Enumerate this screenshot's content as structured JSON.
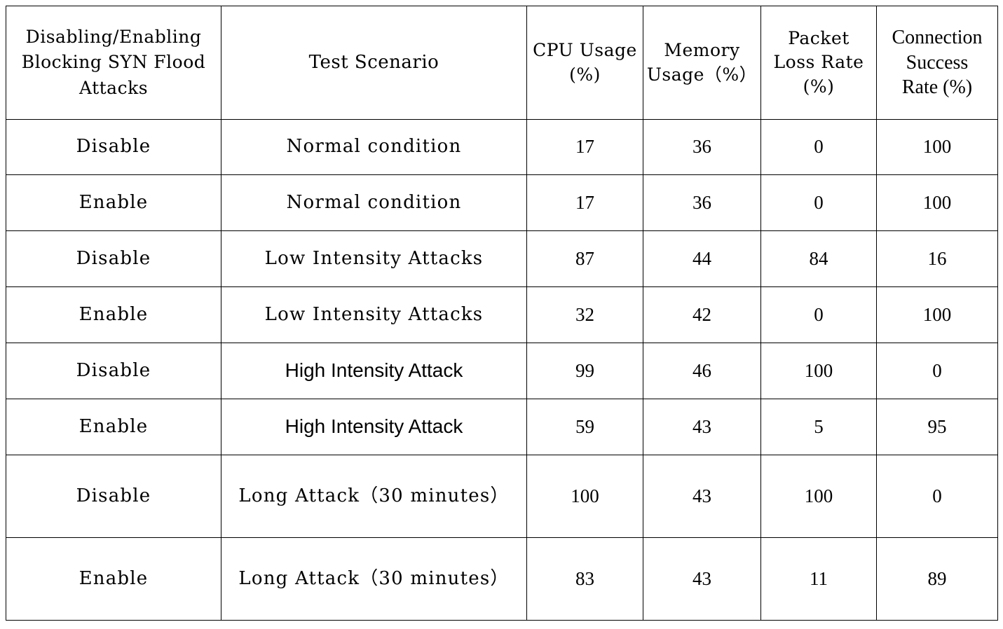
{
  "table": {
    "columns": [
      {
        "id": "toggle",
        "lines": [
          "Disabling/Enabling",
          "Blocking SYN Flood",
          "Attacks"
        ],
        "style": "mono"
      },
      {
        "id": "scenario",
        "lines": [
          "Test Scenario"
        ],
        "style": "mono"
      },
      {
        "id": "cpu",
        "lines": [
          "CPU Usage",
          "(%)"
        ],
        "style": "mono"
      },
      {
        "id": "memory",
        "lines": [
          "Memory",
          "Usage（%）"
        ],
        "style": "mono"
      },
      {
        "id": "loss",
        "lines": [
          "Packet",
          "Loss Rate",
          "(%)"
        ],
        "style": "mono"
      },
      {
        "id": "conn",
        "lines": [
          "Connection",
          "Success",
          "Rate (%)"
        ],
        "style": "serif-bold"
      }
    ],
    "header_texts": {
      "toggle_l1": "Disabling/Enabling",
      "toggle_l2": "Blocking SYN Flood",
      "toggle_l3": "Attacks",
      "scenario": "Test Scenario",
      "cpu_l1": "CPU Usage",
      "cpu_l2": "(%)",
      "memory_l1": "Memory",
      "memory_l2": "Usage（%）",
      "loss_l1": "Packet",
      "loss_l2": "Loss Rate",
      "loss_l3": "(%)",
      "conn_l1": "Connection",
      "conn_l2": "Success",
      "conn_l3": "Rate (%)"
    },
    "rows": [
      {
        "toggle": "Disable",
        "scenario": "Normal condition",
        "scenario_style": "mono",
        "cpu": "17",
        "memory": "36",
        "loss": "0",
        "conn": "100",
        "height": "first"
      },
      {
        "toggle": "Enable",
        "scenario": "Normal condition",
        "scenario_style": "mono",
        "cpu": "17",
        "memory": "36",
        "loss": "0",
        "conn": "100",
        "height": "std"
      },
      {
        "toggle": "Disable",
        "scenario": "Low Intensity Attacks",
        "scenario_style": "mono",
        "cpu": "87",
        "memory": "44",
        "loss": "84",
        "conn": "16",
        "height": "std"
      },
      {
        "toggle": "Enable",
        "scenario": "Low Intensity Attacks",
        "scenario_style": "mono",
        "cpu": "32",
        "memory": "42",
        "loss": "0",
        "conn": "100",
        "height": "std"
      },
      {
        "toggle": "Disable",
        "scenario": "High Intensity Attack",
        "scenario_style": "sans",
        "cpu": "99",
        "memory": "46",
        "loss": "100",
        "conn": "0",
        "height": "std"
      },
      {
        "toggle": "Enable",
        "scenario": "High Intensity Attack",
        "scenario_style": "sans",
        "cpu": "59",
        "memory": "43",
        "loss": "5",
        "conn": "95",
        "height": "std"
      },
      {
        "toggle": "Disable",
        "scenario": "Long Attack（30 minutes）",
        "scenario_style": "mono",
        "cpu": "100",
        "memory": "43",
        "loss": "100",
        "conn": "0",
        "height": "tall"
      },
      {
        "toggle": "Enable",
        "scenario": "Long Attack（30 minutes）",
        "scenario_style": "mono",
        "cpu": "83",
        "memory": "43",
        "loss": "11",
        "conn": "89",
        "height": "tall"
      }
    ]
  },
  "chart_data": {
    "type": "table",
    "title": "",
    "columns": [
      "Disabling/Enabling Blocking SYN Flood Attacks",
      "Test Scenario",
      "CPU Usage (%)",
      "Memory Usage (%)",
      "Packet Loss Rate (%)",
      "Connection Success Rate (%)"
    ],
    "rows": [
      [
        "Disable",
        "Normal condition",
        17,
        36,
        0,
        100
      ],
      [
        "Enable",
        "Normal condition",
        17,
        36,
        0,
        100
      ],
      [
        "Disable",
        "Low Intensity Attacks",
        87,
        44,
        84,
        16
      ],
      [
        "Enable",
        "Low Intensity Attacks",
        32,
        42,
        0,
        100
      ],
      [
        "Disable",
        "High Intensity Attack",
        99,
        46,
        100,
        0
      ],
      [
        "Enable",
        "High Intensity Attack",
        59,
        43,
        5,
        95
      ],
      [
        "Disable",
        "Long Attack (30 minutes)",
        100,
        43,
        100,
        0
      ],
      [
        "Enable",
        "Long Attack (30 minutes)",
        83,
        43,
        11,
        89
      ]
    ]
  },
  "colors": {
    "border": "#000000",
    "text": "#000000",
    "background": "#ffffff"
  }
}
